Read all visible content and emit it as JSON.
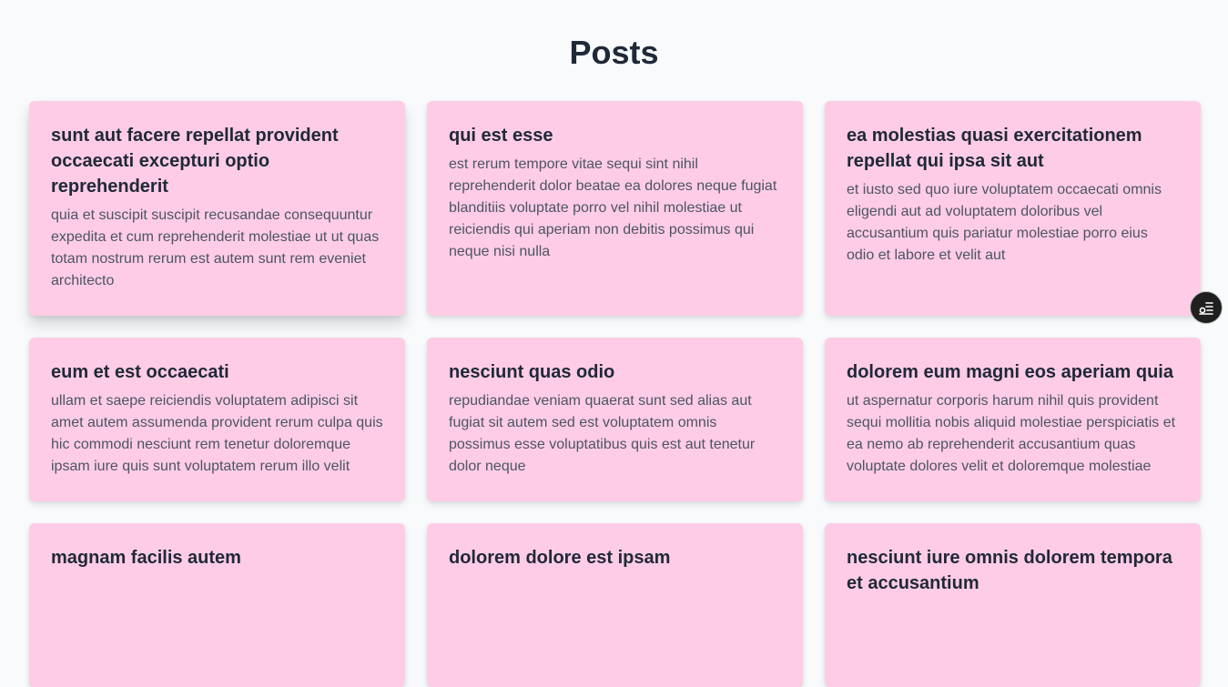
{
  "page": {
    "title": "Posts"
  },
  "posts": [
    {
      "title": "sunt aut facere repellat provident occaecati excepturi optio reprehenderit",
      "body": "quia et suscipit suscipit recusandae consequuntur expedita et cum reprehenderit molestiae ut ut quas totam nostrum rerum est autem sunt rem eveniet architecto"
    },
    {
      "title": "qui est esse",
      "body": "est rerum tempore vitae sequi sint nihil reprehenderit dolor beatae ea dolores neque fugiat blanditiis voluptate porro vel nihil molestiae ut reiciendis qui aperiam non debitis possimus qui neque nisi nulla"
    },
    {
      "title": "ea molestias quasi exercitationem repellat qui ipsa sit aut",
      "body": "et iusto sed quo iure voluptatem occaecati omnis eligendi aut ad voluptatem doloribus vel accusantium quis pariatur molestiae porro eius odio et labore et velit aut"
    },
    {
      "title": "eum et est occaecati",
      "body": "ullam et saepe reiciendis voluptatem adipisci sit amet autem assumenda provident rerum culpa quis hic commodi nesciunt rem tenetur doloremque ipsam iure quis sunt voluptatem rerum illo velit"
    },
    {
      "title": "nesciunt quas odio",
      "body": "repudiandae veniam quaerat sunt sed alias aut fugiat sit autem sed est voluptatem omnis possimus esse voluptatibus quis est aut tenetur dolor neque"
    },
    {
      "title": "dolorem eum magni eos aperiam quia",
      "body": "ut aspernatur corporis harum nihil quis provident sequi mollitia nobis aliquid molestiae perspiciatis et ea nemo ab reprehenderit accusantium quas voluptate dolores velit et doloremque molestiae"
    },
    {
      "title": "magnam facilis autem",
      "body": ""
    },
    {
      "title": "dolorem dolore est ipsam",
      "body": ""
    },
    {
      "title": "nesciunt iure omnis dolorem tempora et accusantium",
      "body": ""
    }
  ],
  "floating_button": {
    "icon": "settings-toggle-icon"
  },
  "colors": {
    "background": "#f8fafc",
    "card": "#ffcce7",
    "title_text": "#1f2937",
    "body_text": "#4b5563",
    "fab": "#1f1f1f"
  }
}
